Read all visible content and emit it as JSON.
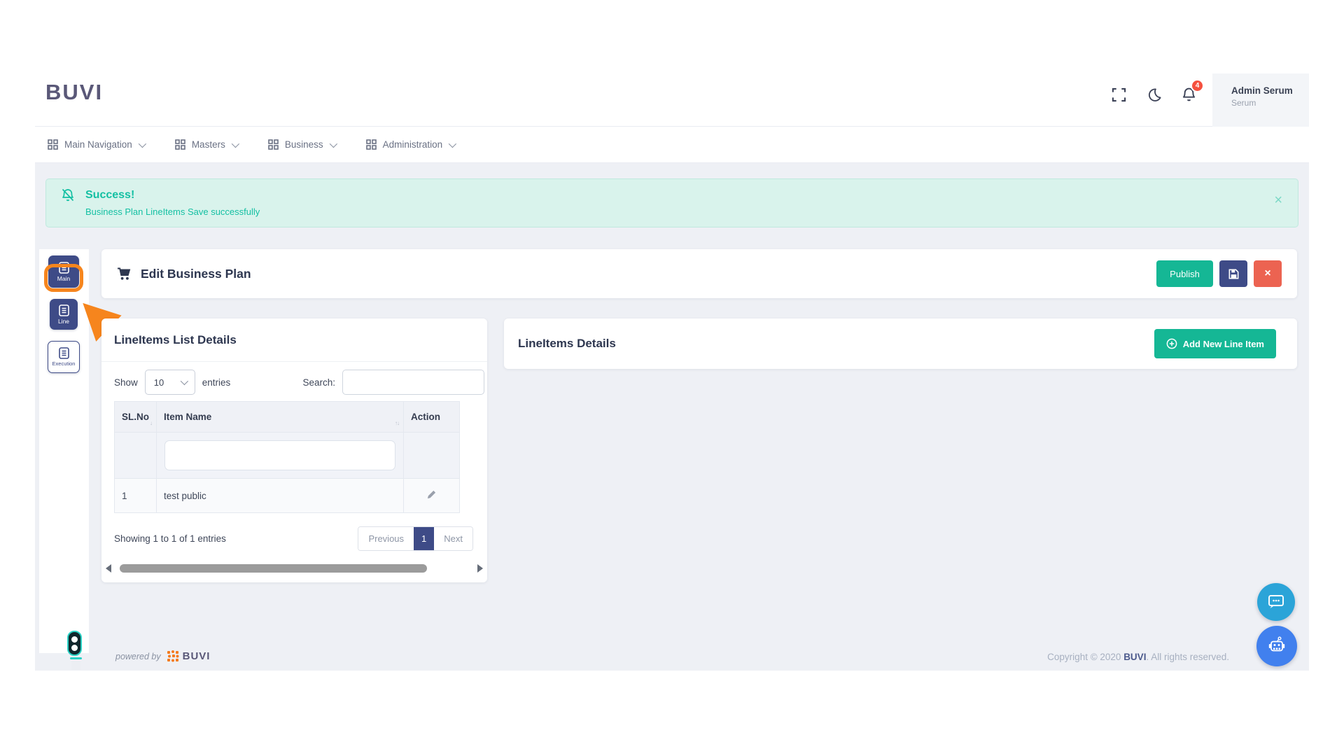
{
  "brand": {
    "name": "BUVI"
  },
  "header": {
    "user": {
      "name": "Admin Serum",
      "role": "Serum"
    },
    "notifications": {
      "count": "4"
    }
  },
  "nav": {
    "items": [
      {
        "label": "Main Navigation"
      },
      {
        "label": "Masters"
      },
      {
        "label": "Business"
      },
      {
        "label": "Administration"
      }
    ]
  },
  "alert": {
    "title": "Success!",
    "message": "Business Plan LineItems Save successfully",
    "close": "×"
  },
  "side_rail": {
    "items": [
      {
        "label": "Main"
      },
      {
        "label": "Line"
      },
      {
        "label": "Execution"
      }
    ]
  },
  "edit_card": {
    "title": "Edit Business Plan",
    "publish": "Publish",
    "close": "×"
  },
  "list_panel": {
    "title": "LineItems List Details",
    "length_label_before": "Show",
    "length_value": "10",
    "length_label_after": "entries",
    "search_label": "Search:",
    "table": {
      "headers": {
        "sl_no": "SL.No",
        "item_name": "Item Name",
        "action": "Action"
      },
      "rows": [
        {
          "sl_no": "1",
          "item_name": "test public"
        }
      ]
    },
    "info": "Showing 1 to 1 of 1 entries",
    "pagination": {
      "previous": "Previous",
      "current": "1",
      "next": "Next"
    }
  },
  "details_panel": {
    "title": "LineItems Details",
    "add_button": "Add New Line Item"
  },
  "footer": {
    "powered_by": "powered by",
    "brand": "BUVI",
    "copyright_prefix": "Copyright © 2020 ",
    "copyright_brand": "BUVI",
    "copyright_suffix": ". All rights reserved."
  },
  "colors": {
    "accent_green": "#15b795",
    "accent_indigo": "#3e4b87",
    "accent_red": "#ec6351",
    "alert_teal": "#14c0a3",
    "annotation_orange": "#f6851d",
    "badge_red": "#f5503e"
  }
}
